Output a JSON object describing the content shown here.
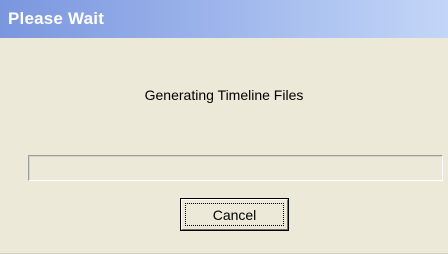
{
  "window": {
    "title": "Please Wait"
  },
  "dialog": {
    "message": "Generating Timeline Files",
    "progress": 0,
    "cancel_label": "Cancel"
  },
  "colors": {
    "titlebar_start": "#7a96df",
    "titlebar_end": "#c3d6f8",
    "dialog_background": "#ece9d8"
  }
}
